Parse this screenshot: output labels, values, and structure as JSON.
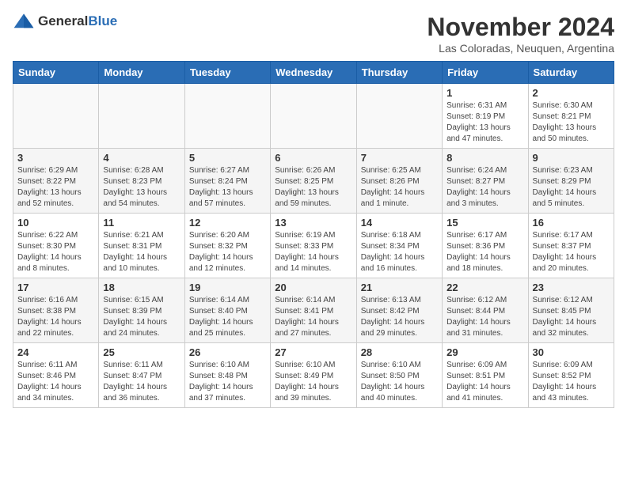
{
  "logo": {
    "general": "General",
    "blue": "Blue"
  },
  "header": {
    "month": "November 2024",
    "location": "Las Coloradas, Neuquen, Argentina"
  },
  "weekdays": [
    "Sunday",
    "Monday",
    "Tuesday",
    "Wednesday",
    "Thursday",
    "Friday",
    "Saturday"
  ],
  "weeks": [
    [
      {
        "day": "",
        "info": ""
      },
      {
        "day": "",
        "info": ""
      },
      {
        "day": "",
        "info": ""
      },
      {
        "day": "",
        "info": ""
      },
      {
        "day": "",
        "info": ""
      },
      {
        "day": "1",
        "info": "Sunrise: 6:31 AM\nSunset: 8:19 PM\nDaylight: 13 hours\nand 47 minutes."
      },
      {
        "day": "2",
        "info": "Sunrise: 6:30 AM\nSunset: 8:21 PM\nDaylight: 13 hours\nand 50 minutes."
      }
    ],
    [
      {
        "day": "3",
        "info": "Sunrise: 6:29 AM\nSunset: 8:22 PM\nDaylight: 13 hours\nand 52 minutes."
      },
      {
        "day": "4",
        "info": "Sunrise: 6:28 AM\nSunset: 8:23 PM\nDaylight: 13 hours\nand 54 minutes."
      },
      {
        "day": "5",
        "info": "Sunrise: 6:27 AM\nSunset: 8:24 PM\nDaylight: 13 hours\nand 57 minutes."
      },
      {
        "day": "6",
        "info": "Sunrise: 6:26 AM\nSunset: 8:25 PM\nDaylight: 13 hours\nand 59 minutes."
      },
      {
        "day": "7",
        "info": "Sunrise: 6:25 AM\nSunset: 8:26 PM\nDaylight: 14 hours\nand 1 minute."
      },
      {
        "day": "8",
        "info": "Sunrise: 6:24 AM\nSunset: 8:27 PM\nDaylight: 14 hours\nand 3 minutes."
      },
      {
        "day": "9",
        "info": "Sunrise: 6:23 AM\nSunset: 8:29 PM\nDaylight: 14 hours\nand 5 minutes."
      }
    ],
    [
      {
        "day": "10",
        "info": "Sunrise: 6:22 AM\nSunset: 8:30 PM\nDaylight: 14 hours\nand 8 minutes."
      },
      {
        "day": "11",
        "info": "Sunrise: 6:21 AM\nSunset: 8:31 PM\nDaylight: 14 hours\nand 10 minutes."
      },
      {
        "day": "12",
        "info": "Sunrise: 6:20 AM\nSunset: 8:32 PM\nDaylight: 14 hours\nand 12 minutes."
      },
      {
        "day": "13",
        "info": "Sunrise: 6:19 AM\nSunset: 8:33 PM\nDaylight: 14 hours\nand 14 minutes."
      },
      {
        "day": "14",
        "info": "Sunrise: 6:18 AM\nSunset: 8:34 PM\nDaylight: 14 hours\nand 16 minutes."
      },
      {
        "day": "15",
        "info": "Sunrise: 6:17 AM\nSunset: 8:36 PM\nDaylight: 14 hours\nand 18 minutes."
      },
      {
        "day": "16",
        "info": "Sunrise: 6:17 AM\nSunset: 8:37 PM\nDaylight: 14 hours\nand 20 minutes."
      }
    ],
    [
      {
        "day": "17",
        "info": "Sunrise: 6:16 AM\nSunset: 8:38 PM\nDaylight: 14 hours\nand 22 minutes."
      },
      {
        "day": "18",
        "info": "Sunrise: 6:15 AM\nSunset: 8:39 PM\nDaylight: 14 hours\nand 24 minutes."
      },
      {
        "day": "19",
        "info": "Sunrise: 6:14 AM\nSunset: 8:40 PM\nDaylight: 14 hours\nand 25 minutes."
      },
      {
        "day": "20",
        "info": "Sunrise: 6:14 AM\nSunset: 8:41 PM\nDaylight: 14 hours\nand 27 minutes."
      },
      {
        "day": "21",
        "info": "Sunrise: 6:13 AM\nSunset: 8:42 PM\nDaylight: 14 hours\nand 29 minutes."
      },
      {
        "day": "22",
        "info": "Sunrise: 6:12 AM\nSunset: 8:44 PM\nDaylight: 14 hours\nand 31 minutes."
      },
      {
        "day": "23",
        "info": "Sunrise: 6:12 AM\nSunset: 8:45 PM\nDaylight: 14 hours\nand 32 minutes."
      }
    ],
    [
      {
        "day": "24",
        "info": "Sunrise: 6:11 AM\nSunset: 8:46 PM\nDaylight: 14 hours\nand 34 minutes."
      },
      {
        "day": "25",
        "info": "Sunrise: 6:11 AM\nSunset: 8:47 PM\nDaylight: 14 hours\nand 36 minutes."
      },
      {
        "day": "26",
        "info": "Sunrise: 6:10 AM\nSunset: 8:48 PM\nDaylight: 14 hours\nand 37 minutes."
      },
      {
        "day": "27",
        "info": "Sunrise: 6:10 AM\nSunset: 8:49 PM\nDaylight: 14 hours\nand 39 minutes."
      },
      {
        "day": "28",
        "info": "Sunrise: 6:10 AM\nSunset: 8:50 PM\nDaylight: 14 hours\nand 40 minutes."
      },
      {
        "day": "29",
        "info": "Sunrise: 6:09 AM\nSunset: 8:51 PM\nDaylight: 14 hours\nand 41 minutes."
      },
      {
        "day": "30",
        "info": "Sunrise: 6:09 AM\nSunset: 8:52 PM\nDaylight: 14 hours\nand 43 minutes."
      }
    ]
  ]
}
